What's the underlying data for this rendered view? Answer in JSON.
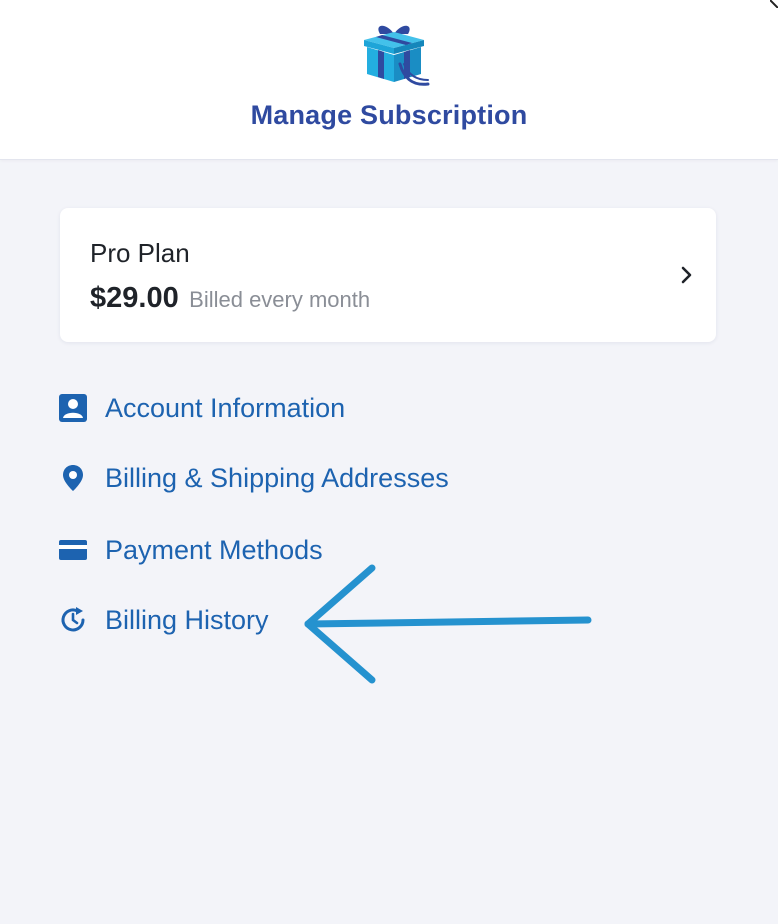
{
  "header": {
    "title": "Manage Subscription",
    "logo_icon": "gift-box-icon"
  },
  "plan_card": {
    "name": "Pro Plan",
    "price": "$29.00",
    "billing_cycle": "Billed every month",
    "chevron_icon": "chevron-right-icon"
  },
  "menu": {
    "items": [
      {
        "label": "Account Information",
        "icon": "account-card-icon"
      },
      {
        "label": "Billing & Shipping Addresses",
        "icon": "map-pin-icon"
      },
      {
        "label": "Payment Methods",
        "icon": "credit-card-icon"
      },
      {
        "label": "Billing History",
        "icon": "history-icon"
      }
    ]
  },
  "annotation": {
    "icon": "arrow-left-icon"
  },
  "colors": {
    "title": "#2f4aa0",
    "link": "#1d63b0",
    "background": "#f3f4f9",
    "card": "#ffffff",
    "annotation_arrow": "#2592cf",
    "muted_text": "#8a8e96"
  }
}
